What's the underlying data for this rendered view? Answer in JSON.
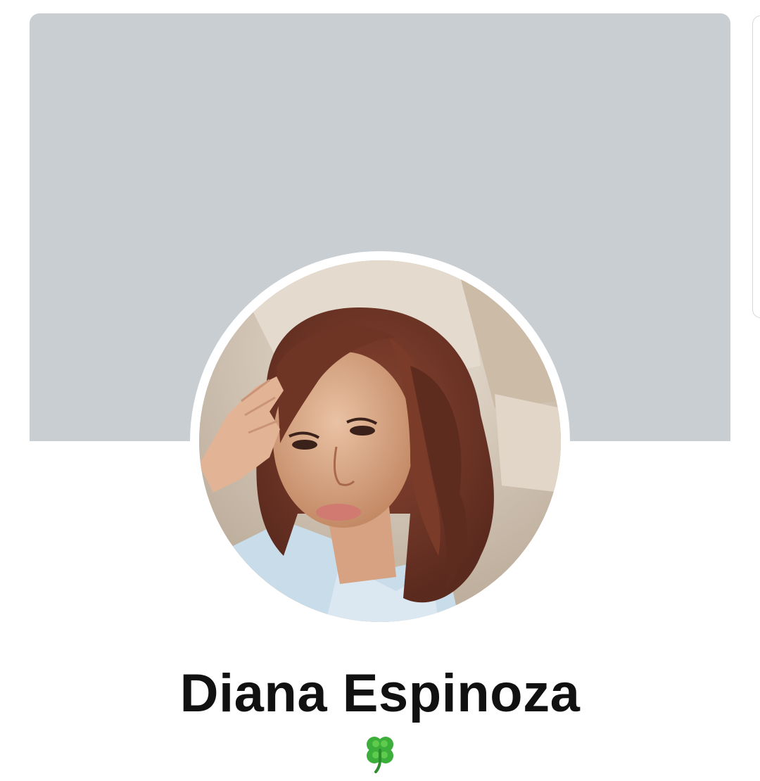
{
  "profile": {
    "name": "Diana Espinoza",
    "bio_emoji": "🍀",
    "bio_icon": "four-leaf-clover-icon",
    "avatar_icon": "profile-photo"
  },
  "colors": {
    "cover": "#c9ced3",
    "background": "#ffffff",
    "name_text": "#111111",
    "clover": "#3cae3a"
  }
}
